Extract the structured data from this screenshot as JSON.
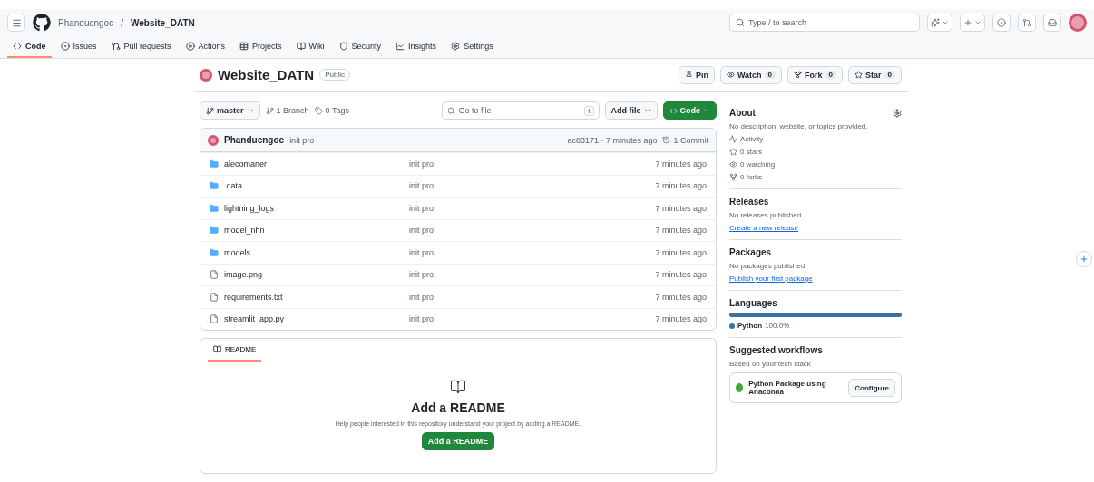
{
  "header": {
    "owner": "Phanducngoc",
    "separator": "/",
    "repo": "Website_DATN",
    "search": {
      "placeholder": "Type / to search"
    }
  },
  "tabs": [
    {
      "label": "Code",
      "selected": true
    },
    {
      "label": "Issues",
      "selected": false
    },
    {
      "label": "Pull requests",
      "selected": false
    },
    {
      "label": "Actions",
      "selected": false
    },
    {
      "label": "Projects",
      "selected": false
    },
    {
      "label": "Wiki",
      "selected": false
    },
    {
      "label": "Security",
      "selected": false
    },
    {
      "label": "Insights",
      "selected": false
    },
    {
      "label": "Settings",
      "selected": false
    }
  ],
  "repo": {
    "name": "Website_DATN",
    "visibility": "Public",
    "actions": [
      {
        "label": "Pin"
      },
      {
        "label": "Watch",
        "count": "0"
      },
      {
        "label": "Fork",
        "count": "0"
      },
      {
        "label": "Star",
        "count": "0"
      }
    ]
  },
  "toolbar": {
    "branch": "master",
    "branches": "1 Branch",
    "tags": "0 Tags",
    "go_to_file": {
      "placeholder": "Go to file"
    },
    "shortcut": "t",
    "add_file": "Add file",
    "code": "Code"
  },
  "commit": {
    "author": "Phanducngoc",
    "message": "init pro",
    "hash_time": "ac83171 · 7 minutes ago",
    "commits": "1 Commit"
  },
  "files": [
    {
      "kind": "folder",
      "name": "alecomaner",
      "message": "init pro",
      "time": "7 minutes ago"
    },
    {
      "kind": "folder",
      "name": ".data",
      "message": "init pro",
      "time": "7 minutes ago"
    },
    {
      "kind": "folder",
      "name": "lightning_logs",
      "message": "init pro",
      "time": "7 minutes ago"
    },
    {
      "kind": "folder",
      "name": "model_nhn",
      "message": "init pro",
      "time": "7 minutes ago"
    },
    {
      "kind": "folder",
      "name": "models",
      "message": "init pro",
      "time": "7 minutes ago"
    },
    {
      "kind": "file",
      "name": "image.png",
      "message": "init pro",
      "time": "7 minutes ago"
    },
    {
      "kind": "file",
      "name": "requirements.txt",
      "message": "init pro",
      "time": "7 minutes ago"
    },
    {
      "kind": "file",
      "name": "streamlit_app.py",
      "message": "init pro",
      "time": "7 minutes ago"
    }
  ],
  "readme": {
    "tab": "README",
    "title": "Add a README",
    "text": "Help people interested in this repository understand your project by adding a README.",
    "button": "Add a README"
  },
  "about": {
    "title": "About",
    "description": "No description, website, or topics provided.",
    "stats": [
      "Activity",
      "0 stars",
      "0 watching",
      "0 forks"
    ]
  },
  "releases": {
    "title": "Releases",
    "text": "No releases published",
    "link": "Create a new release"
  },
  "packages": {
    "title": "Packages",
    "text": "No packages published",
    "link": "Publish your first package"
  },
  "languages": {
    "title": "Languages",
    "items": [
      {
        "name": "Python",
        "percent": "100.0%",
        "color": "#3572a5",
        "level": 1
      }
    ]
  },
  "workflows": {
    "title": "Suggested workflows",
    "subtitle": "Based on your tech stack",
    "items": [
      {
        "name": "Python Package using Anaconda",
        "button": "Configure"
      }
    ]
  }
}
